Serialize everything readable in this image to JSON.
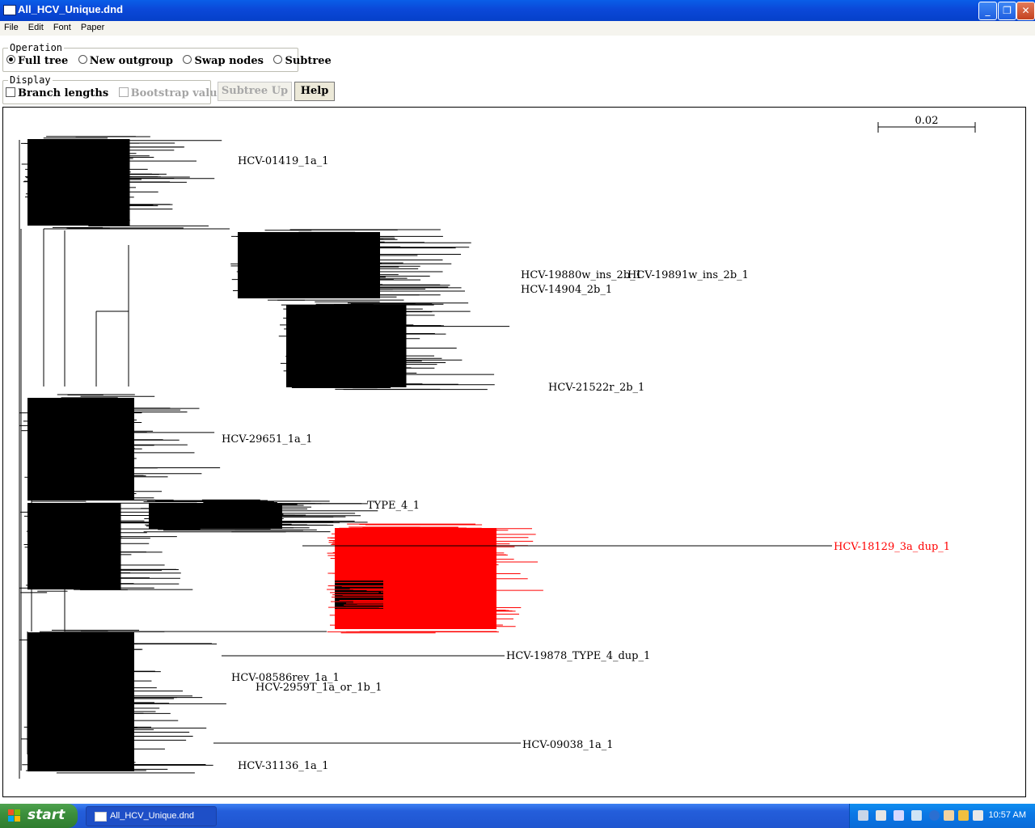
{
  "window": {
    "title": "All_HCV_Unique.dnd",
    "icon": "window-app-icon"
  },
  "menu": [
    "File",
    "Edit",
    "Font",
    "Paper"
  ],
  "operation": {
    "legend": "Operation",
    "options": [
      "Full tree",
      "New outgroup",
      "Swap nodes",
      "Subtree"
    ],
    "selected": "Full tree"
  },
  "display": {
    "legend": "Display",
    "branch_lengths": {
      "label": "Branch lengths",
      "checked": false
    },
    "bootstrap_values": {
      "label": "Bootstrap values",
      "checked": false,
      "enabled": false
    }
  },
  "buttons": {
    "subtree_up": "Subtree Up",
    "help": "Help"
  },
  "tree": {
    "scale_label": "0.02",
    "colors": {
      "branch": "#000000",
      "highlight": "#ff0000"
    },
    "leaf_labels": [
      {
        "text": "HCV-01419_1a_1",
        "color": "#000000"
      },
      {
        "text": "HCV-19880w_ins_2b_1",
        "color": "#000000"
      },
      {
        "text": "HCV-19891w_ins_2b_1",
        "color": "#000000"
      },
      {
        "text": "HCV-14904_2b_1",
        "color": "#000000"
      },
      {
        "text": "HCV-21522r_2b_1",
        "color": "#000000"
      },
      {
        "text": "HCV-29651_1a_1",
        "color": "#000000"
      },
      {
        "text": "TYPE_4_1",
        "color": "#000000"
      },
      {
        "text": "HCV-18129_3a_dup_1",
        "color": "#ff0000"
      },
      {
        "text": "HCV-19878_TYPE_4_dup_1",
        "color": "#000000"
      },
      {
        "text": "HCV-08586rev_1a_1",
        "color": "#000000"
      },
      {
        "text": "HCV-2959T_1a_or_1b_1",
        "color": "#000000"
      },
      {
        "text": "HCV-09038_1a_1",
        "color": "#000000"
      },
      {
        "text": "HCV-31136_1a_1",
        "color": "#000000"
      }
    ]
  },
  "taskbar": {
    "start_label": "start",
    "active_task": "All_HCV_Unique.dnd",
    "clock": "10:57 AM"
  }
}
